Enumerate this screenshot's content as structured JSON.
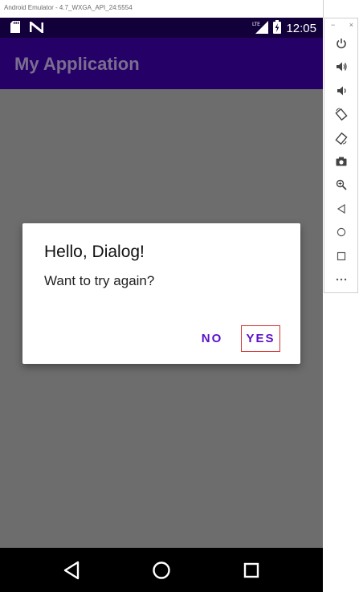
{
  "window": {
    "title": "Android Emulator - 4.7_WXGA_API_24:5554"
  },
  "statusbar": {
    "time": "12:05",
    "network": "LTE",
    "icons": [
      "sd-card-icon",
      "n-notification-icon",
      "lte-signal-icon",
      "battery-charging-icon"
    ]
  },
  "appbar": {
    "title": "My Application"
  },
  "dialog": {
    "title": "Hello, Dialog!",
    "message": "Want to try again?",
    "negative_label": "NO",
    "positive_label": "YES"
  },
  "navbar": {
    "buttons": [
      "back-icon",
      "home-icon",
      "recents-icon"
    ]
  },
  "toolbar": {
    "minimize": "−",
    "close": "×",
    "buttons": [
      "power-icon",
      "volume-up-icon",
      "volume-down-icon",
      "rotate-left-icon",
      "rotate-right-icon",
      "camera-icon",
      "zoom-icon",
      "back-icon",
      "home-icon",
      "overview-icon",
      "more-icon"
    ]
  },
  "colors": {
    "statusbar": "#12003a",
    "appbar": "#250066",
    "accent": "#5a0fc8",
    "scrim": "#6d6d6d",
    "focus_border": "#d32f2f"
  }
}
